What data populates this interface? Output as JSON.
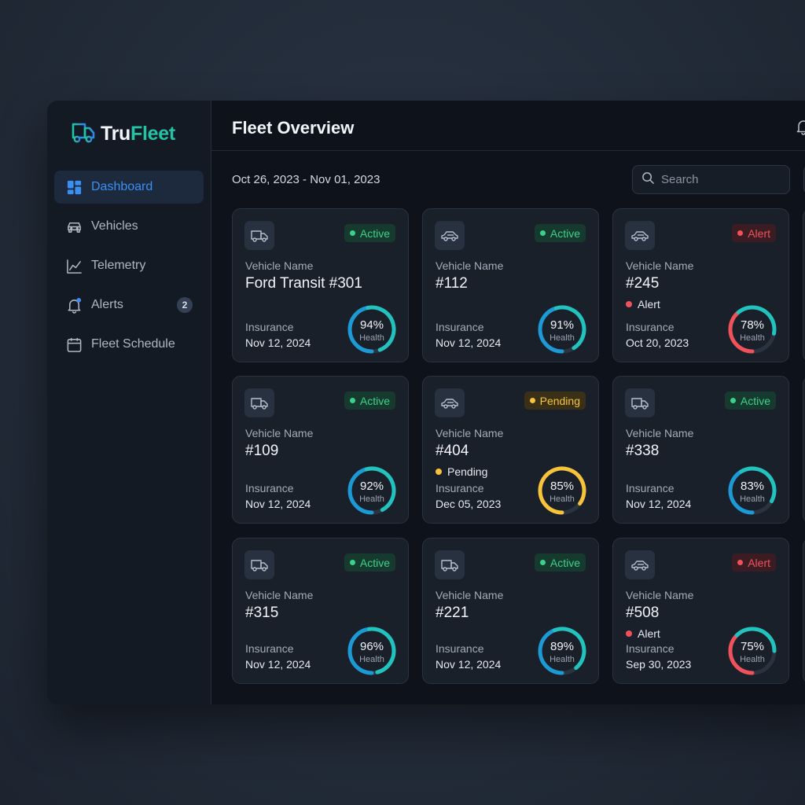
{
  "app": {
    "brand_primary": "Tru",
    "brand_secondary": "Fleet"
  },
  "sidebar": {
    "items": [
      {
        "label": "Dashboard",
        "icon": "dashboard-icon",
        "active": true
      },
      {
        "label": "Vehicles",
        "icon": "car-icon"
      },
      {
        "label": "Telemetry",
        "icon": "chart-line-icon"
      },
      {
        "label": "Alerts",
        "icon": "bell-icon",
        "badge": "2"
      },
      {
        "label": "Fleet Schedule",
        "icon": "calendar-icon"
      }
    ]
  },
  "header": {
    "title": "Fleet Overview",
    "notification_icon": "bell-icon"
  },
  "toolbar": {
    "date_range": "Oct 26, 2023 - Nov 01, 2023",
    "search_placeholder": "Search"
  },
  "labels": {
    "vehicle_name": "Vehicle Name",
    "insurance": "Insurance",
    "health": "Health"
  },
  "colors": {
    "accent_blue": "#3b8ff3",
    "brand_teal": "#22c3a6",
    "active_green": "#3bd18c",
    "alert_red": "#f0525c",
    "pending_yellow": "#f6c33b",
    "gauge_blue": "#1c9ad6",
    "gauge_teal": "#22c3bf"
  },
  "vehicles": [
    {
      "name": "Ford Transit #301",
      "status": "Active",
      "type": "van",
      "sub_status": "",
      "insurance": "Nov 12, 2024",
      "health": "94%",
      "health_pct": 94,
      "gauge_color": "blue"
    },
    {
      "name": "#112",
      "status": "Active",
      "type": "car",
      "sub_status": "",
      "insurance": "Nov 12, 2024",
      "health": "91%",
      "health_pct": 91,
      "gauge_color": "blue"
    },
    {
      "name": "#245",
      "status": "Alert",
      "type": "car",
      "sub_status": "Alert",
      "insurance": "Oct 20, 2023",
      "health": "78%",
      "health_pct": 78,
      "gauge_color": "red"
    },
    {
      "name": "#109",
      "status": "Active",
      "type": "van",
      "sub_status": "",
      "insurance": "Nov 12, 2024",
      "health": "92%",
      "health_pct": 92,
      "gauge_color": "blue"
    },
    {
      "name": "#404",
      "status": "Pending",
      "type": "car",
      "sub_status": "Pending",
      "insurance": "Dec 05, 2023",
      "health": "85%",
      "health_pct": 85,
      "gauge_color": "yellow"
    },
    {
      "name": "#338",
      "status": "Active",
      "type": "van",
      "sub_status": "",
      "insurance": "Nov 12, 2024",
      "health": "83%",
      "health_pct": 83,
      "gauge_color": "blue"
    },
    {
      "name": "#315",
      "status": "Active",
      "type": "van",
      "sub_status": "",
      "insurance": "Nov 12, 2024",
      "health": "96%",
      "health_pct": 96,
      "gauge_color": "blue"
    },
    {
      "name": "#221",
      "status": "Active",
      "type": "van",
      "sub_status": "",
      "insurance": "Nov 12, 2024",
      "health": "89%",
      "health_pct": 89,
      "gauge_color": "blue"
    },
    {
      "name": "#508",
      "status": "Alert",
      "type": "car",
      "sub_status": "Alert",
      "insurance": "Sep 30, 2023",
      "health": "75%",
      "health_pct": 75,
      "gauge_color": "red"
    }
  ]
}
